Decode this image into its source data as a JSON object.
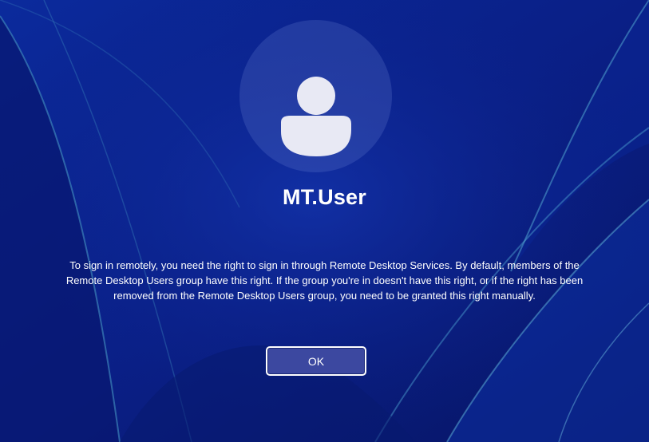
{
  "login": {
    "username": "MT.User",
    "message": "To sign in remotely, you need the right to sign in through Remote Desktop Services. By default, members of the Remote Desktop Users group have this right. If the group you're in doesn't have this right, or if the right has been removed from the Remote Desktop Users group, you need to be granted this right manually.",
    "ok_label": "OK"
  },
  "icons": {
    "avatar": "user-icon"
  },
  "colors": {
    "background": "#0a1f86",
    "button_fill": "#3c48a0",
    "button_border": "#ffffff",
    "text": "#ffffff"
  }
}
